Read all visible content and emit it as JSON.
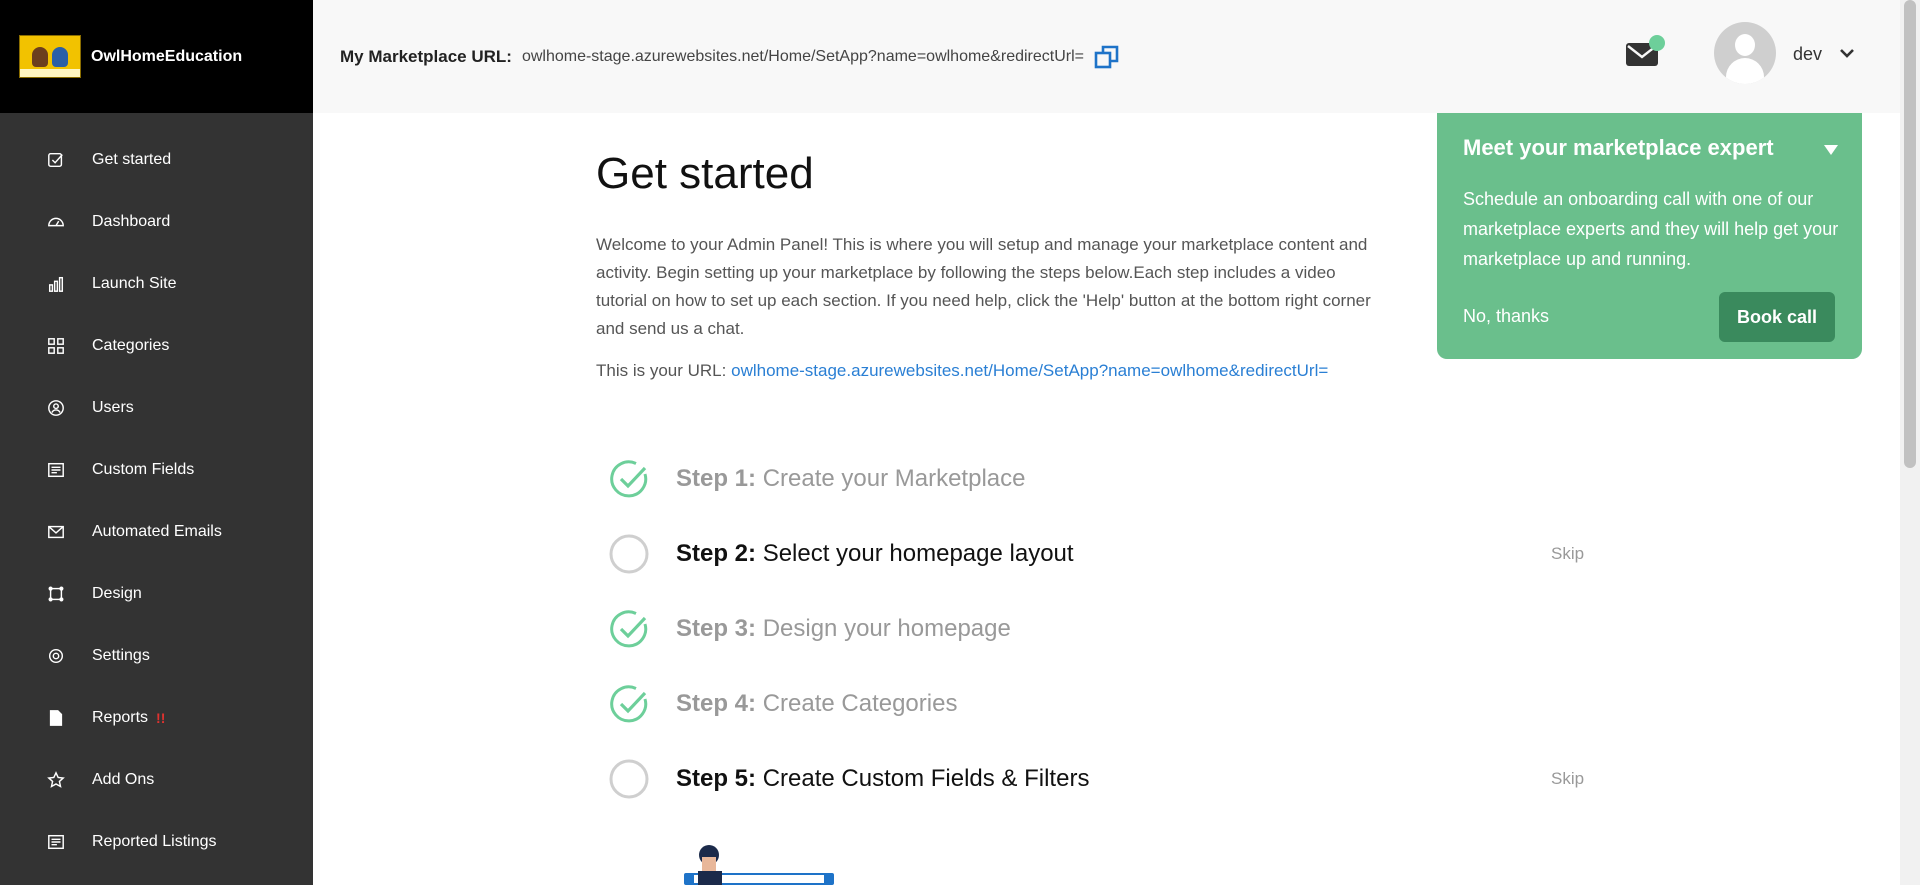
{
  "brand": {
    "name": "OwlHomeEducation"
  },
  "sidebar": {
    "items": [
      {
        "label": "Get started",
        "icon": "check-square-icon"
      },
      {
        "label": "Dashboard",
        "icon": "gauge-icon"
      },
      {
        "label": "Launch Site",
        "icon": "bar-chart-icon"
      },
      {
        "label": "Categories",
        "icon": "grid-icon"
      },
      {
        "label": "Users",
        "icon": "user-circle-icon"
      },
      {
        "label": "Custom Fields",
        "icon": "form-icon"
      },
      {
        "label": "Automated Emails",
        "icon": "envelope-icon"
      },
      {
        "label": "Design",
        "icon": "crop-icon"
      },
      {
        "label": "Settings",
        "icon": "gear-icon"
      },
      {
        "label": "Reports",
        "icon": "document-icon",
        "alert": "!!"
      },
      {
        "label": "Add Ons",
        "icon": "star-icon"
      },
      {
        "label": "Reported Listings",
        "icon": "form-icon"
      }
    ]
  },
  "header": {
    "url_label": "My Marketplace URL:",
    "url_value": "owlhome-stage.azurewebsites.net/Home/SetApp?name=owlhome&redirectUrl=",
    "user_name": "dev"
  },
  "main": {
    "title": "Get started",
    "intro": "Welcome to your Admin Panel! This is where you will setup and manage your marketplace content and activity. Begin setting up your marketplace by following the steps below.Each step includes a video tutorial on how to set up each section. If you need help, click the 'Help' button at the bottom right corner and send us a chat.",
    "url_prefix": "This is your URL:",
    "url_link": "owlhome-stage.azurewebsites.net/Home/SetApp?name=owlhome&redirectUrl=",
    "skip_label": "Skip",
    "steps": [
      {
        "number": "Step 1:",
        "title": "Create your Marketplace",
        "status": "done"
      },
      {
        "number": "Step 2:",
        "title": "Select your homepage layout",
        "status": "todo"
      },
      {
        "number": "Step 3:",
        "title": "Design your homepage",
        "status": "done"
      },
      {
        "number": "Step 4:",
        "title": "Create Categories",
        "status": "done"
      },
      {
        "number": "Step 5:",
        "title": "Create Custom Fields & Filters",
        "status": "todo"
      }
    ]
  },
  "expert_card": {
    "title": "Meet your marketplace expert",
    "text": "Schedule an onboarding call with one of our marketplace experts and they will help get your marketplace up and running.",
    "dismiss_label": "No, thanks",
    "book_label": "Book call"
  },
  "colors": {
    "sidebar_bg": "#333333",
    "brand_bg": "#000000",
    "accent_green": "#6abf8c",
    "button_green": "#3a8a5d",
    "link_blue": "#2a7fd4",
    "check_green": "#6dcf9a"
  }
}
